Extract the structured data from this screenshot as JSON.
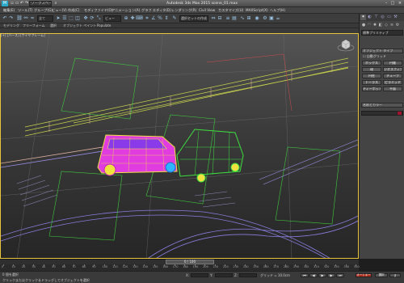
{
  "titlebar": {
    "workspace": "ワークスペース: 既定",
    "title": "Autodesk 3ds Max 2015   scene_01.max",
    "app_icon": "M"
  },
  "menubar": {
    "items": [
      "編集(E)",
      "ツール(T)",
      "グループ(G)",
      "ビュー(V)",
      "作成(C)",
      "モディファイヤ(O)",
      "アニメーション(A)",
      "グラフ エディタ(D)",
      "レンダリング(R)",
      "Civil View",
      "カスタマイズ(U)",
      "MAXScript(X)",
      "ヘルプ(H)"
    ]
  },
  "toolbar": {
    "selection_set": "全て",
    "view_dropdown": "ビュー",
    "named_sel": "選択セットの作成"
  },
  "ribbon": {
    "tabs": [
      "モデリング",
      "フリーフォーム",
      "選択",
      "オブジェクト ペイント",
      "Populate"
    ]
  },
  "viewport": {
    "label": "[+] [パース] [ワイヤフレーム]"
  },
  "command_panel": {
    "category": "標準プリミティブ",
    "rollout_object_type": "オブジェクト タイプ",
    "autogrid": "自動グリッド",
    "buttons": [
      "ボックス",
      "円錐",
      "球",
      "ジオスフィア",
      "円柱",
      "チューブ",
      "トーラス",
      "ピラミッド",
      "ティーポット",
      "平面"
    ],
    "rollout_name_color": "名前とカラー"
  },
  "timeline": {
    "slider": "0 / 100",
    "ticks": [
      "0",
      "10",
      "20",
      "30",
      "40",
      "50",
      "60",
      "70",
      "80",
      "90",
      "100",
      "110",
      "120",
      "130",
      "140",
      "150",
      "160",
      "170",
      "180",
      "190",
      "200",
      "210",
      "220",
      "230",
      "240",
      "250",
      "260",
      "270",
      "280",
      "290",
      "300",
      "310",
      "320",
      "330",
      "340",
      "350"
    ]
  },
  "statusbar": {
    "selection_text": "0 個を選択",
    "prompt": "クリックまたはクリック＆ドラッグしてオブジェクトを選択",
    "x": "X:",
    "y": "Y:",
    "z": "Z:",
    "grid": "グリッド = 10.0cm",
    "autokey": "オートキー",
    "setkey": "選択"
  },
  "colors": {
    "viewport_border": "#e8c53a",
    "autokey": "#b03020",
    "selected_button": "#6b88b8"
  }
}
